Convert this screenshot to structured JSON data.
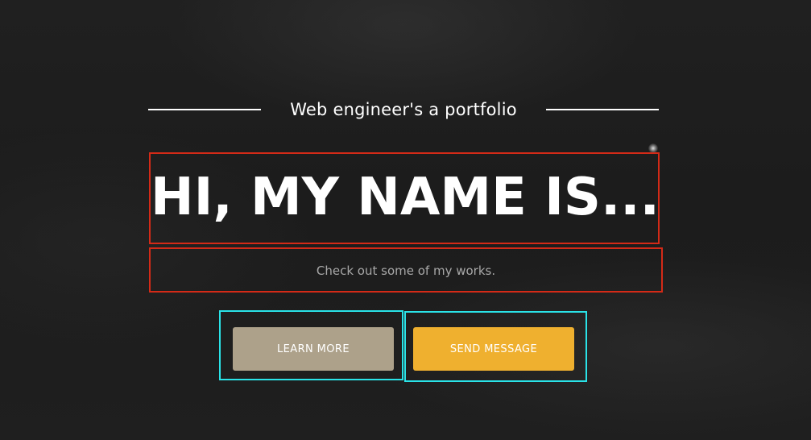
{
  "hero": {
    "subtitle": "Web engineer's a portfolio",
    "headline": "HI, MY NAME IS...",
    "tagline": "Check out some of my works."
  },
  "actions": {
    "learn_more_label": "LEARN MORE",
    "send_message_label": "SEND MESSAGE"
  },
  "colors": {
    "background": "#1d1d1d",
    "headline_text": "#ffffff",
    "tagline_text": "#a8a8a8",
    "learn_more_bg": "#ada18a",
    "send_message_bg": "#efb02f",
    "annotation_red": "#d42a17",
    "annotation_cyan": "#2ae3e8"
  }
}
